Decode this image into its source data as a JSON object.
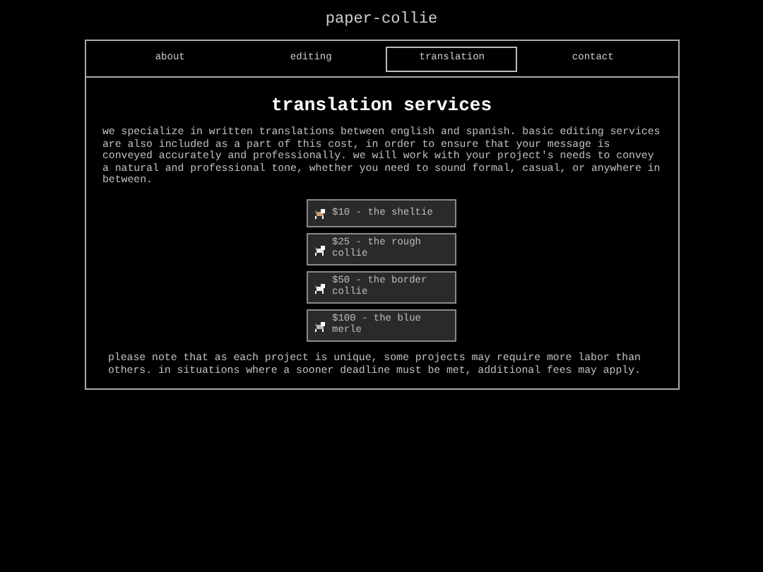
{
  "site_title": "paper-collie",
  "nav": [
    {
      "label": "about",
      "selected": false
    },
    {
      "label": "editing",
      "selected": false
    },
    {
      "label": "translation",
      "selected": true
    },
    {
      "label": "contact",
      "selected": false
    }
  ],
  "heading": "translation services",
  "intro": "we specialize in written translations between english and spanish. basic editing services are also included as a part of this cost, in order to ensure that your message is conveyed accurately and professionally. we will work with your project's needs to convey a natural and professional tone, whether you need to sound formal, casual, or anywhere in between.",
  "prices": [
    {
      "label": "$10 - the sheltie"
    },
    {
      "label": "$25 - the rough collie"
    },
    {
      "label": "$50 - the border collie"
    },
    {
      "label": "$100 - the blue merle"
    }
  ],
  "note": "please note that as each project is unique, some projects may require more labor than others. in situations where a sooner deadline must be met, additional fees may apply."
}
